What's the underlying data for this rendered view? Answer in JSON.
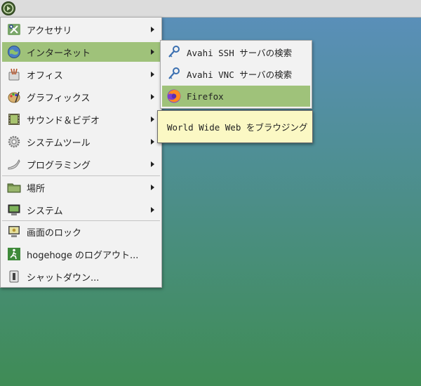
{
  "main_menu": {
    "items": [
      {
        "label": "アクセサリ",
        "icon": "accessories-icon",
        "submenu": true
      },
      {
        "label": "インターネット",
        "icon": "globe-icon",
        "submenu": true,
        "active": true
      },
      {
        "label": "オフィス",
        "icon": "office-icon",
        "submenu": true
      },
      {
        "label": "グラフィックス",
        "icon": "palette-icon",
        "submenu": true
      },
      {
        "label": "サウンド＆ビデオ",
        "icon": "film-icon",
        "submenu": true
      },
      {
        "label": "システムツール",
        "icon": "gear-icon",
        "submenu": true
      },
      {
        "label": "プログラミング",
        "icon": "programming-icon",
        "submenu": true
      },
      {
        "label": "場所",
        "icon": "folder-icon",
        "submenu": true
      },
      {
        "label": "システム",
        "icon": "monitor-icon",
        "submenu": true
      },
      {
        "label": "画面のロック",
        "icon": "lock-screen-icon",
        "submenu": false
      },
      {
        "label": "hogehoge のログアウト...",
        "icon": "exit-icon",
        "submenu": false
      },
      {
        "label": "シャットダウン...",
        "icon": "power-switch-icon",
        "submenu": false
      }
    ]
  },
  "sub_menu": {
    "items": [
      {
        "label": "Avahi SSH サーバの検索",
        "icon": "search-key-icon"
      },
      {
        "label": "Avahi VNC サーバの検索",
        "icon": "search-key-icon"
      },
      {
        "label": "Firefox",
        "icon": "firefox-icon",
        "active": true
      }
    ]
  },
  "tooltip": {
    "text": "World Wide Web をブラウジング"
  },
  "colors": {
    "highlight": "#9fc27a",
    "menu_bg": "#f2f2f2",
    "tooltip_bg": "#fbf8c4"
  }
}
